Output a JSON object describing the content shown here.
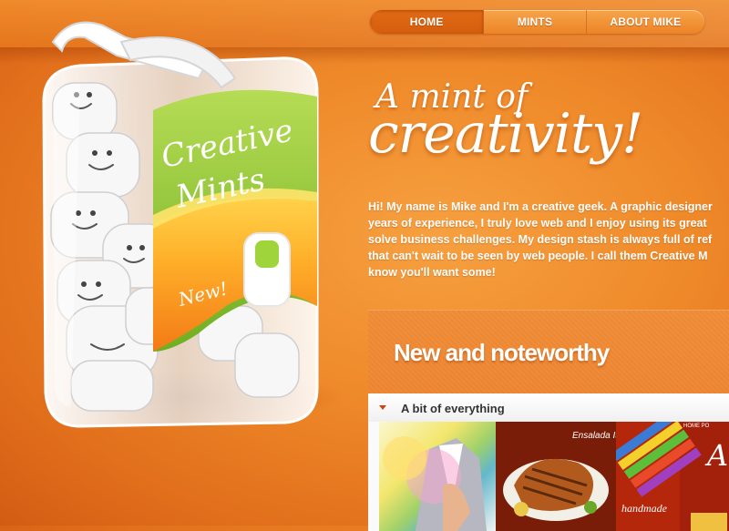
{
  "nav": {
    "items": [
      {
        "label": "HOME",
        "active": true
      },
      {
        "label": "MINTS",
        "active": false
      },
      {
        "label": "ABOUT MIKE",
        "active": false
      }
    ]
  },
  "product": {
    "line1": "Creative",
    "line2": "Mints",
    "badge": "New!"
  },
  "headline": {
    "line1": "A mint of",
    "line2": "creativity!"
  },
  "intro": {
    "lines": [
      "Hi! My name is Mike and I'm a creative geek. A graphic designer",
      "years of experience, I truly love web and I enjoy using its great",
      "solve business challenges. My design stash is always full of ref",
      "that can't wait to be seen by web people. I call them Creative M",
      "know you'll want some!"
    ]
  },
  "noteworthy": {
    "title": "New and noteworthy",
    "section_title": "A bit of everything",
    "thumb_text": {
      "t1_label": "handmade",
      "t2_label": "Ensalada Ita",
      "t3_nav": "HOME      PO",
      "t3_script": "An"
    }
  },
  "colors": {
    "accent": "#e5761d",
    "mint_green": "#8cc63f",
    "arrow": "#d1440c"
  }
}
